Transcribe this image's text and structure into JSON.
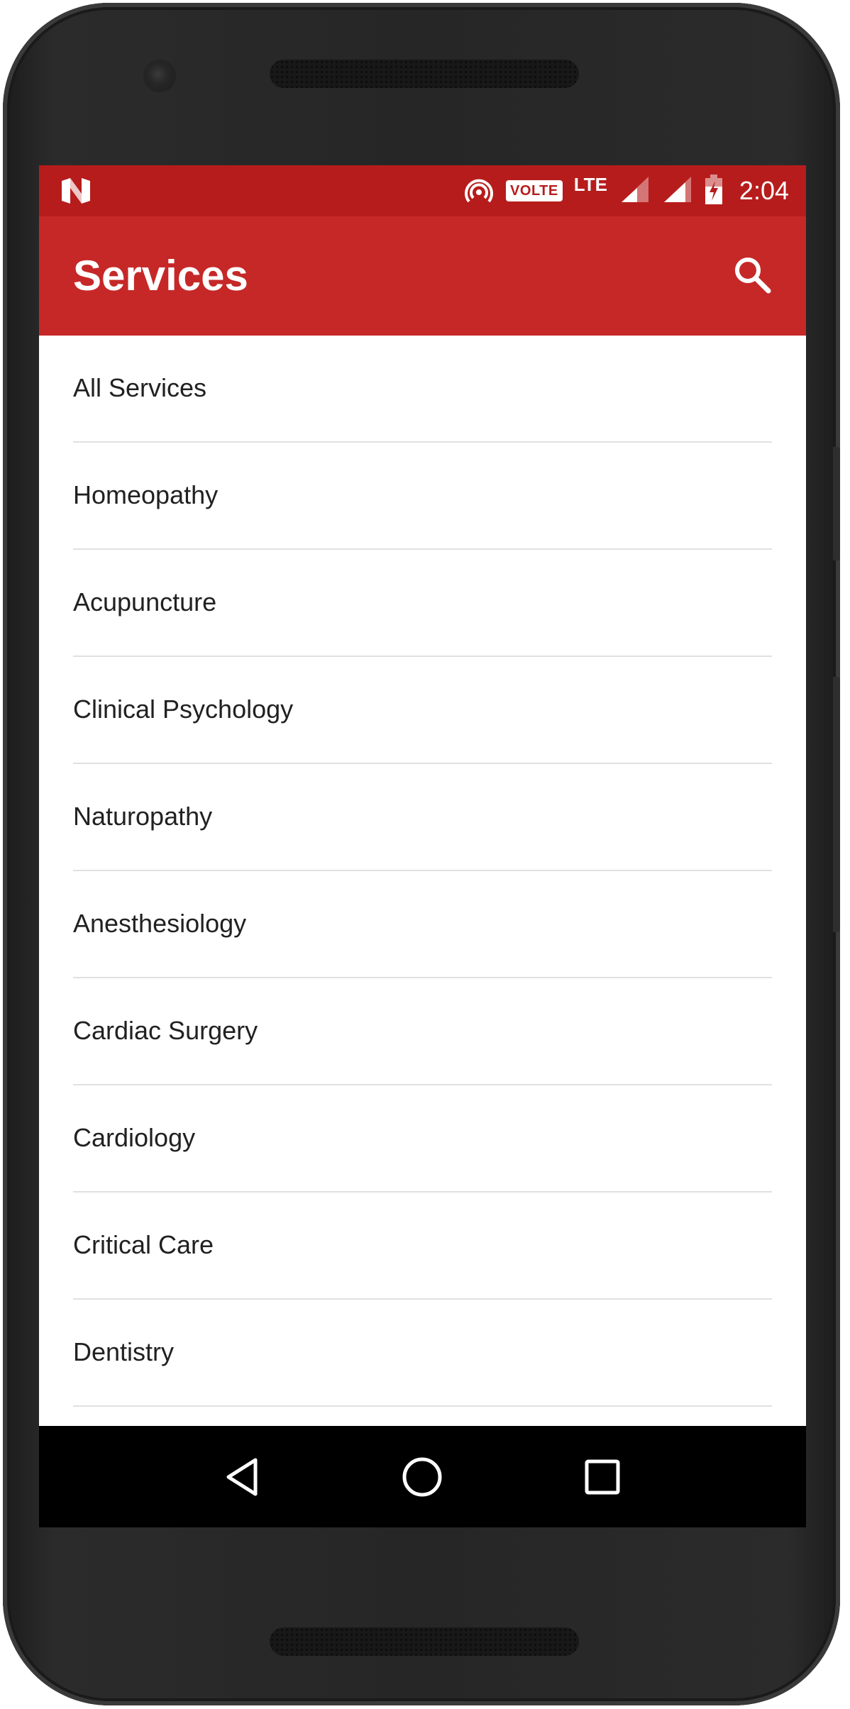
{
  "status_bar": {
    "time": "2:04",
    "volte": "VOLTE",
    "network": "LTE",
    "icons": [
      "n-logo-icon",
      "hotspot-icon",
      "signal-icon",
      "signal-icon",
      "battery-charging-icon"
    ]
  },
  "app_bar": {
    "title": "Services",
    "search_icon": "search-icon",
    "color": "#c62828",
    "status_color": "#b71c1c"
  },
  "services": [
    {
      "label": "All Services"
    },
    {
      "label": "Homeopathy"
    },
    {
      "label": "Acupuncture"
    },
    {
      "label": "Clinical Psychology"
    },
    {
      "label": "Naturopathy"
    },
    {
      "label": "Anesthesiology"
    },
    {
      "label": "Cardiac Surgery"
    },
    {
      "label": "Cardiology"
    },
    {
      "label": "Critical Care"
    },
    {
      "label": "Dentistry"
    }
  ],
  "nav_bar": {
    "icons": [
      "back-icon",
      "home-icon",
      "recents-icon"
    ]
  }
}
